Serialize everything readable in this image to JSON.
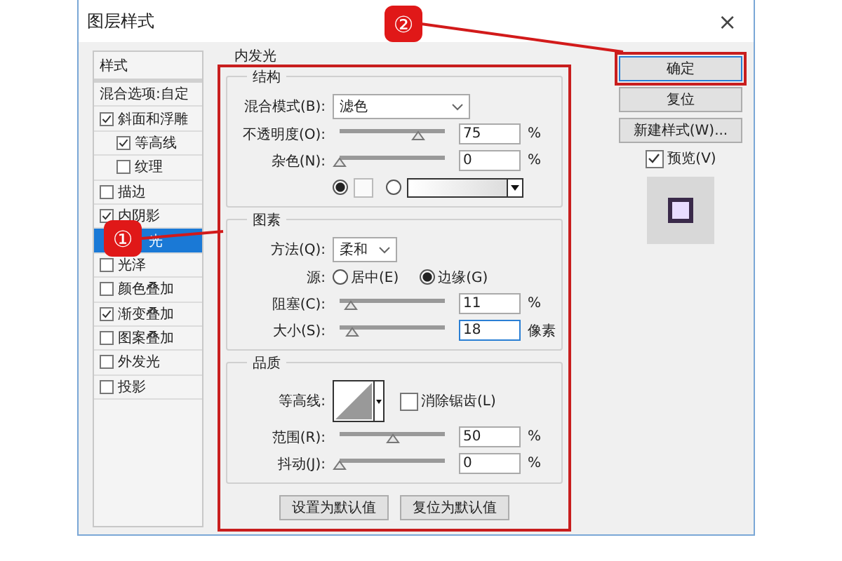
{
  "window": {
    "title": "图层样式",
    "close": "×"
  },
  "styles": {
    "header": "样式",
    "items": [
      {
        "kind": "plain",
        "label": "混合选项:自定",
        "selected": false
      },
      {
        "kind": "check",
        "label": "斜面和浮雕",
        "checked": true,
        "selected": false,
        "children": [
          {
            "kind": "check",
            "label": "等高线",
            "checked": true,
            "selected": false
          },
          {
            "kind": "check",
            "label": "纹理",
            "checked": false,
            "selected": false
          }
        ]
      },
      {
        "kind": "check",
        "label": "描边",
        "checked": false,
        "selected": false
      },
      {
        "kind": "check",
        "label": "内阴影",
        "checked": true,
        "selected": false
      },
      {
        "kind": "covered",
        "label": "光",
        "selected": true
      },
      {
        "kind": "check",
        "label": "光泽",
        "checked": false,
        "selected": false
      },
      {
        "kind": "check",
        "label": "颜色叠加",
        "checked": false,
        "selected": false
      },
      {
        "kind": "check",
        "label": "渐变叠加",
        "checked": true,
        "selected": false
      },
      {
        "kind": "check",
        "label": "图案叠加",
        "checked": false,
        "selected": false
      },
      {
        "kind": "check",
        "label": "外发光",
        "checked": false,
        "selected": false
      },
      {
        "kind": "check",
        "label": "投影",
        "checked": false,
        "selected": false
      }
    ]
  },
  "panel": {
    "title": "内发光",
    "sections": [
      {
        "title": "结构",
        "rows": [
          {
            "kind": "dropdown",
            "label": "混合模式(B):",
            "value": "滤色"
          },
          {
            "kind": "slider",
            "label": "不透明度(O):",
            "level": 0.75,
            "value": "75",
            "unit": "%",
            "focused": false
          },
          {
            "kind": "slider",
            "label": "杂色(N):",
            "level": 0,
            "value": "0",
            "unit": "%",
            "focused": false
          },
          {
            "kind": "color",
            "options": [
              {
                "kind": "swatch",
                "selected": true
              },
              {
                "kind": "gradient",
                "selected": false
              }
            ]
          }
        ]
      },
      {
        "title": "图素",
        "rows": [
          {
            "kind": "dropdown",
            "label": "方法(Q):",
            "value": "柔和"
          },
          {
            "kind": "radio",
            "label": "源:",
            "options": [
              {
                "label": "居中(E)",
                "selected": false
              },
              {
                "label": "边缘(G)",
                "selected": true
              }
            ]
          },
          {
            "kind": "slider",
            "label": "阻塞(C):",
            "level": 0.11,
            "value": "11",
            "unit": "%",
            "focused": false
          },
          {
            "kind": "slider",
            "label": "大小(S):",
            "level": 0.12,
            "value": "18",
            "unit": "像素",
            "focused": true
          }
        ]
      },
      {
        "title": "品质",
        "rows": [
          {
            "kind": "contour",
            "label": "等高线:",
            "checkbox": {
              "label": "消除锯齿(L)",
              "checked": false
            }
          },
          {
            "kind": "slider",
            "label": "范围(R):",
            "level": 0.5,
            "value": "50",
            "unit": "%",
            "focused": false
          },
          {
            "kind": "slider",
            "label": "抖动(J):",
            "level": 0,
            "value": "0",
            "unit": "%",
            "focused": false
          }
        ]
      }
    ],
    "buttons": [
      "设置为默认值",
      "复位为默认值"
    ]
  },
  "actions": {
    "buttons": [
      {
        "label": "确定",
        "default": true
      },
      {
        "label": "复位",
        "default": false
      },
      {
        "label": "新建样式(W)...",
        "default": false
      }
    ],
    "preview": {
      "label": "预览(V)",
      "checked": true
    }
  },
  "annotations": [
    {
      "number": "①"
    },
    {
      "number": "②"
    }
  ]
}
